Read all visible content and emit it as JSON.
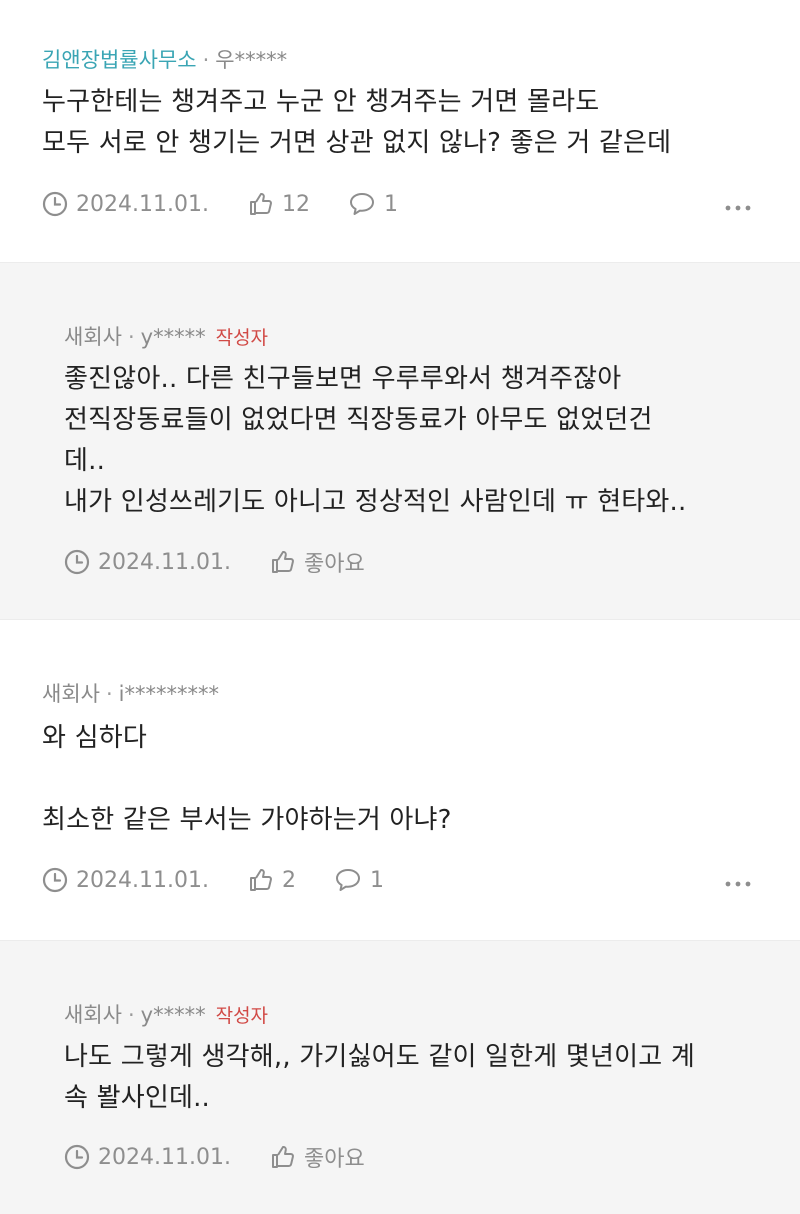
{
  "comments": [
    {
      "company": "김앤장법률사무소",
      "separator": "·",
      "user": "우*****",
      "lines": [
        "누구한테는 챙겨주고 누군 안 챙겨주는 거면 몰라도",
        "모두 서로 안 챙기는 거면 상관 없지 않나? 좋은 거 같은데"
      ],
      "date": "2024.11.01.",
      "likes": "12",
      "replies": "1"
    },
    {
      "company": "새회사",
      "separator": "·",
      "user": "y*****",
      "badge": "작성자",
      "lines": [
        "좋진않아.. 다른 친구들보면 우루루와서 챙겨주잖아",
        "전직장동료들이 없었다면 직장동료가 아무도 없었던건",
        "데..",
        "내가 인성쓰레기도 아니고 정상적인 사람인데 ㅠ 현타와.."
      ],
      "date": "2024.11.01.",
      "like_label": "좋아요"
    },
    {
      "company": "새회사",
      "separator": "·",
      "user": "i*********",
      "lines": [
        "와 심하다",
        "",
        "최소한 같은 부서는 가야하는거 아냐?"
      ],
      "date": "2024.11.01.",
      "likes": "2",
      "replies": "1"
    },
    {
      "company": "새회사",
      "separator": "·",
      "user": "y*****",
      "badge": "작성자",
      "lines": [
        "나도 그렇게 생각해,, 가기싫어도 같이 일한게 몇년이고 계",
        "속 봘사인데.."
      ],
      "date": "2024.11.01.",
      "like_label": "좋아요"
    }
  ],
  "icons": {
    "clock": "clock-icon",
    "like": "thumbs-up-icon",
    "reply": "speech-bubble-icon",
    "more": "more-dots-icon"
  },
  "colors": {
    "company_link": "#3aa5b4",
    "author_badge": "#d14a46",
    "meta_gray": "#8a8a8a",
    "reply_background": "#f5f5f5"
  }
}
